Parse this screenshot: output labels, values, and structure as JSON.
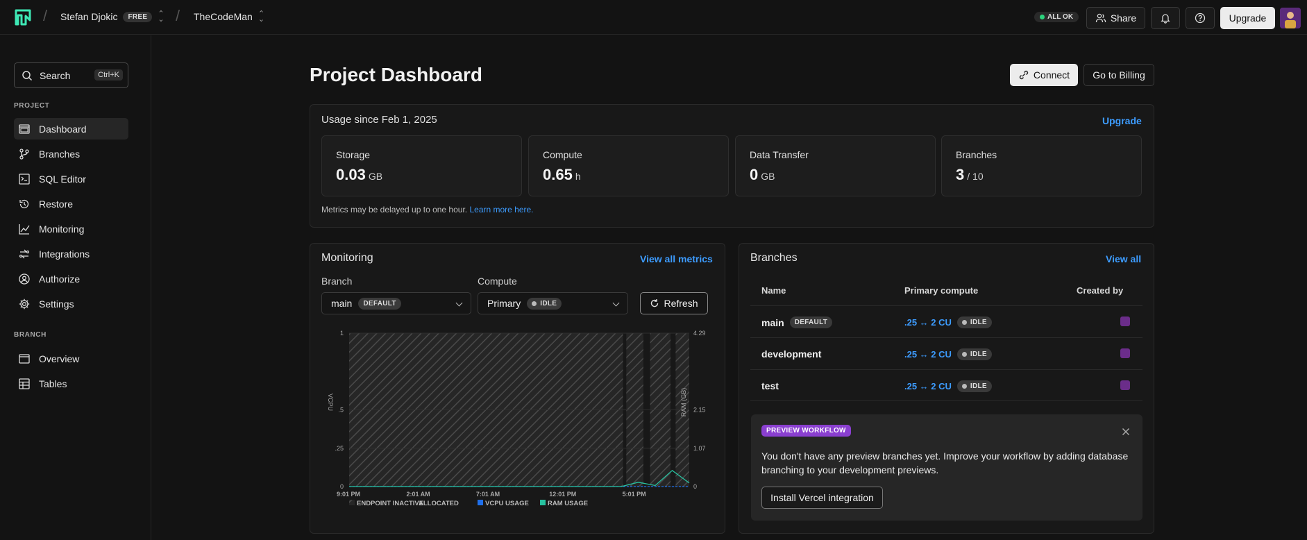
{
  "topbar": {
    "user": "Stefan Djokic",
    "plan": "FREE",
    "project": "TheCodeMan",
    "status": "ALL OK",
    "share": "Share",
    "upgrade": "Upgrade"
  },
  "sidebar": {
    "search": "Search",
    "shortcut": "Ctrl+K",
    "project_section": "PROJECT",
    "project_items": [
      "Dashboard",
      "Branches",
      "SQL Editor",
      "Restore",
      "Monitoring",
      "Integrations",
      "Authorize",
      "Settings"
    ],
    "branch_section": "BRANCH",
    "branch_items": [
      "Overview",
      "Tables"
    ]
  },
  "page": {
    "title": "Project Dashboard",
    "connect": "Connect",
    "billing": "Go to Billing"
  },
  "usage": {
    "title": "Usage since Feb 1, 2025",
    "upgrade": "Upgrade",
    "stats": [
      {
        "label": "Storage",
        "value": "0.03",
        "unit": "GB"
      },
      {
        "label": "Compute",
        "value": "0.65",
        "unit": "h"
      },
      {
        "label": "Data Transfer",
        "value": "0",
        "unit": "GB"
      },
      {
        "label": "Branches",
        "value": "3",
        "unit": "/ 10"
      }
    ],
    "note": "Metrics may be delayed up to one hour.",
    "note_link": "Learn more here."
  },
  "monitoring": {
    "title": "Monitoring",
    "view_all": "View all metrics",
    "branch_label": "Branch",
    "branch_value": "main",
    "branch_badge": "DEFAULT",
    "compute_label": "Compute",
    "compute_value": "Primary",
    "compute_badge": "IDLE",
    "refresh": "Refresh"
  },
  "chart_data": {
    "type": "area",
    "x_ticks": [
      "9:01 PM",
      "2:01 AM",
      "7:01 AM",
      "12:01 PM",
      "5:01 PM"
    ],
    "y_left_label": "VCPU",
    "y_left_ticks": [
      "1",
      ".5",
      ".25",
      "0"
    ],
    "y_right_label": "RAM (GB)",
    "y_right_ticks": [
      "4.29",
      "2.15",
      "1.07",
      "0"
    ],
    "ylim_left": [
      0,
      1
    ],
    "ylim_right": [
      0,
      4.29
    ],
    "legend": [
      "ENDPOINT INACTIVE",
      "ALLOCATED",
      "VCPU USAGE",
      "RAM USAGE"
    ],
    "colors": {
      "vcpu": "#1f6feb",
      "ram": "#27c2a0",
      "inactive": "#555555"
    },
    "series": [
      {
        "name": "VCPU USAGE",
        "values": [
          0,
          0,
          0,
          0,
          0,
          0,
          0,
          0,
          0,
          0,
          0,
          0,
          0
        ]
      },
      {
        "name": "RAM USAGE",
        "values": [
          0,
          0,
          0,
          0,
          0,
          0,
          0,
          0,
          0,
          0.12,
          0.03,
          0.45,
          0.1
        ]
      }
    ],
    "inactive_periods": [
      [
        "9:01 PM",
        "4:30 PM"
      ],
      "4:40 PM–5:00 PM",
      "5:10 PM–5:40 PM",
      "5:55 PM–6:30 PM"
    ]
  },
  "branches": {
    "title": "Branches",
    "view_all": "View all",
    "headers": [
      "Name",
      "Primary compute",
      "Created by"
    ],
    "rows": [
      {
        "name": "main",
        "badge": "DEFAULT",
        "compute": ".25 ↔ 2 CU",
        "state": "IDLE"
      },
      {
        "name": "development",
        "badge": "",
        "compute": ".25 ↔ 2 CU",
        "state": "IDLE"
      },
      {
        "name": "test",
        "badge": "",
        "compute": ".25 ↔ 2 CU",
        "state": "IDLE"
      }
    ]
  },
  "preview": {
    "badge": "PREVIEW WORKFLOW",
    "text": "You don't have any preview branches yet. Improve your workflow by adding database branching to your development previews.",
    "button": "Install Vercel integration"
  }
}
